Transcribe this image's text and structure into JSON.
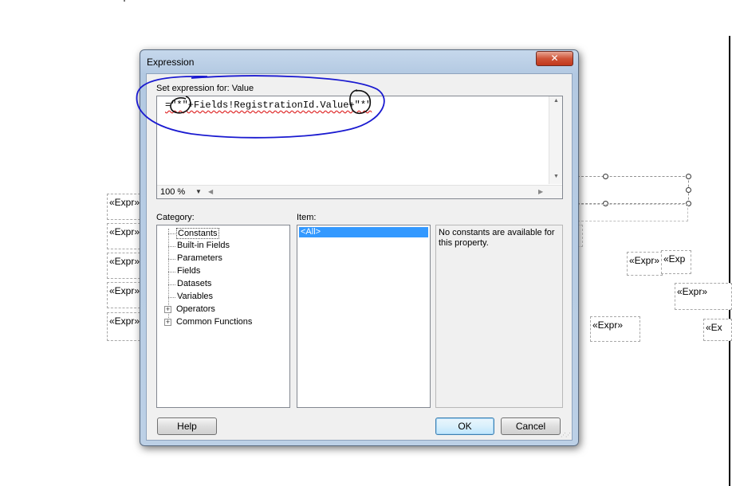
{
  "background": {
    "expr_boxes": [
      "«Expr»",
      "«Expr»",
      "«Expr»",
      "«Expr»",
      "«Expr»",
      "«Expr»",
      "«Exp",
      "«Expr»",
      "«Expr»",
      "«Ex"
    ]
  },
  "dialog": {
    "title": "Expression",
    "close_glyph": "✕",
    "set_expression_label": "Set expression for: Value",
    "expression_text": "=\"*\"+Fields!RegistrationId.Value+\"*\"",
    "zoom": "100 %",
    "category_label": "Category:",
    "item_label": "Item:",
    "categories": [
      {
        "label": "Constants",
        "expandable": false
      },
      {
        "label": "Built-in Fields",
        "expandable": false
      },
      {
        "label": "Parameters",
        "expandable": false
      },
      {
        "label": "Fields",
        "expandable": false
      },
      {
        "label": "Datasets",
        "expandable": false
      },
      {
        "label": "Variables",
        "expandable": false
      },
      {
        "label": "Operators",
        "expandable": true
      },
      {
        "label": "Common Functions",
        "expandable": true
      }
    ],
    "items": [
      "<All>"
    ],
    "description": "No constants are available for this property.",
    "help_label": "Help",
    "ok_label": "OK",
    "cancel_label": "Cancel"
  },
  "colors": {
    "annotation_ink": "#1a1ad0",
    "selection": "#3399ff",
    "close_button": "#c1381c"
  }
}
